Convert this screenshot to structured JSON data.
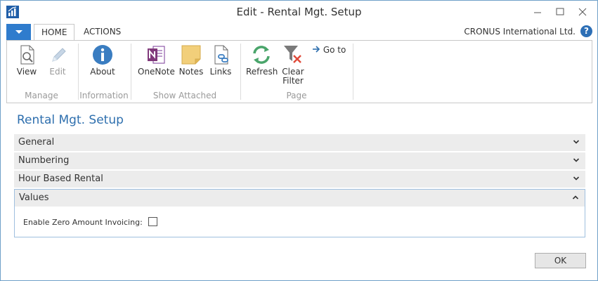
{
  "window": {
    "title": "Edit - Rental Mgt. Setup"
  },
  "ribbon": {
    "tabs": [
      {
        "label": "HOME",
        "active": true
      },
      {
        "label": "ACTIONS",
        "active": false
      }
    ],
    "company": "CRONUS International Ltd.",
    "help_icon": "?",
    "groups": {
      "manage": {
        "label": "Manage",
        "buttons": [
          {
            "label": "View",
            "icon": "view-icon",
            "enabled": true
          },
          {
            "label": "Edit",
            "icon": "edit-pencil-icon",
            "enabled": false
          }
        ]
      },
      "information": {
        "label": "Information",
        "buttons": [
          {
            "label": "About",
            "icon": "info-icon",
            "enabled": true
          }
        ]
      },
      "show_attached": {
        "label": "Show Attached",
        "buttons": [
          {
            "label": "OneNote",
            "icon": "onenote-icon",
            "enabled": true
          },
          {
            "label": "Notes",
            "icon": "notes-icon",
            "enabled": true
          },
          {
            "label": "Links",
            "icon": "links-icon",
            "enabled": true
          }
        ]
      },
      "page": {
        "label": "Page",
        "buttons": [
          {
            "label": "Refresh",
            "icon": "refresh-icon",
            "enabled": true
          },
          {
            "label_line1": "Clear",
            "label_line2": "Filter",
            "icon": "clear-filter-icon",
            "enabled": true
          }
        ],
        "goto_label": "Go to"
      }
    }
  },
  "page": {
    "title": "Rental Mgt. Setup",
    "fasttabs": [
      {
        "label": "General",
        "expanded": false
      },
      {
        "label": "Numbering",
        "expanded": false
      },
      {
        "label": "Hour Based Rental",
        "expanded": false
      },
      {
        "label": "Values",
        "expanded": true
      }
    ],
    "values_fields": [
      {
        "label": "Enable Zero Amount Invoicing:",
        "checked": false
      }
    ]
  },
  "footer": {
    "ok_label": "OK"
  },
  "colors": {
    "accent": "#2e6fae",
    "file_button": "#2f7ccd",
    "fasttab_bg": "#ececec",
    "window_border": "#6fa0c9"
  }
}
